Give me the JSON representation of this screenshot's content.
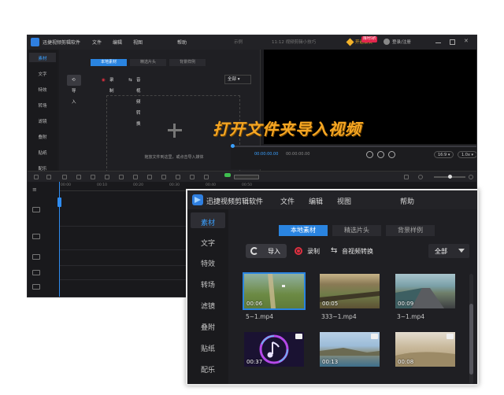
{
  "banner": {
    "text": "打开文件夹导入视频"
  },
  "back_window": {
    "app_name": "迅捷视频剪辑软件",
    "menu": [
      "文件",
      "编辑",
      "视图",
      "帮助"
    ],
    "title_center": "示例",
    "status_text": "11:12 视频剪辑小技巧",
    "vip_label": "开通会员",
    "badge": "限时5折",
    "login_label": "登录/注册",
    "sidebar": [
      "素材",
      "文字",
      "特效",
      "转场",
      "滤镜",
      "叠附",
      "贴纸",
      "配乐"
    ],
    "tabs": [
      "本地素材",
      "精选片头",
      "背景样例"
    ],
    "toolbar": {
      "import": "导入",
      "record": "录制",
      "convert": "音视频转换",
      "filter": "全部"
    },
    "drop_hint": "拖放文件到这里，或点击导入媒体",
    "time_current": "00:00:00.00",
    "time_total": "00:00:00.00",
    "aspect": "16:9",
    "speed": "1.0x",
    "ruler": [
      "00:00",
      "00:10",
      "00:20",
      "00:30",
      "00:40",
      "00:50"
    ]
  },
  "front_window": {
    "app_name": "迅捷视频剪辑软件",
    "menu": [
      "文件",
      "编辑",
      "视图",
      "帮助"
    ],
    "sidebar": [
      "素材",
      "文字",
      "特效",
      "转场",
      "滤镜",
      "叠附",
      "贴纸",
      "配乐"
    ],
    "tabs": [
      "本地素材",
      "精选片头",
      "背景样例"
    ],
    "toolbar": {
      "import": "导入",
      "record": "录制",
      "convert": "音视频转换",
      "filter": "全部"
    },
    "media": [
      {
        "name": "5~1.mp4",
        "duration": "00:06"
      },
      {
        "name": "333~1.mp4",
        "duration": "00:05"
      },
      {
        "name": "3~1.mp4",
        "duration": "00:09"
      },
      {
        "name": "",
        "duration": "00:37"
      },
      {
        "name": "",
        "duration": "00:13"
      },
      {
        "name": "",
        "duration": "00:08"
      }
    ]
  }
}
